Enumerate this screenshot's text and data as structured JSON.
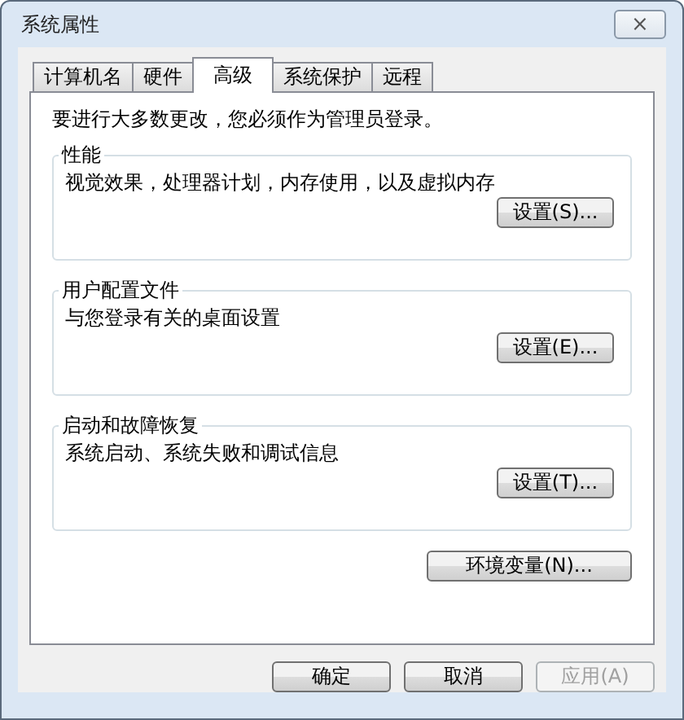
{
  "window": {
    "title": "系统属性",
    "close_label": "⨯"
  },
  "tabs": [
    {
      "label": "计算机名",
      "selected": false
    },
    {
      "label": "硬件",
      "selected": false
    },
    {
      "label": "高级",
      "selected": true
    },
    {
      "label": "系统保护",
      "selected": false
    },
    {
      "label": "远程",
      "selected": false
    }
  ],
  "notice": "要进行大多数更改，您必须作为管理员登录。",
  "groups": [
    {
      "title": "性能",
      "description": "视觉效果，处理器计划，内存使用，以及虚拟内存",
      "button": "设置(S)..."
    },
    {
      "title": "用户配置文件",
      "description": "与您登录有关的桌面设置",
      "button": "设置(E)..."
    },
    {
      "title": "启动和故障恢复",
      "description": "系统启动、系统失败和调试信息",
      "button": "设置(T)..."
    }
  ],
  "env_button": "环境变量(N)...",
  "dialog_buttons": [
    {
      "label": "确定",
      "disabled": false
    },
    {
      "label": "取消",
      "disabled": false
    },
    {
      "label": "应用(A)",
      "disabled": true
    }
  ]
}
